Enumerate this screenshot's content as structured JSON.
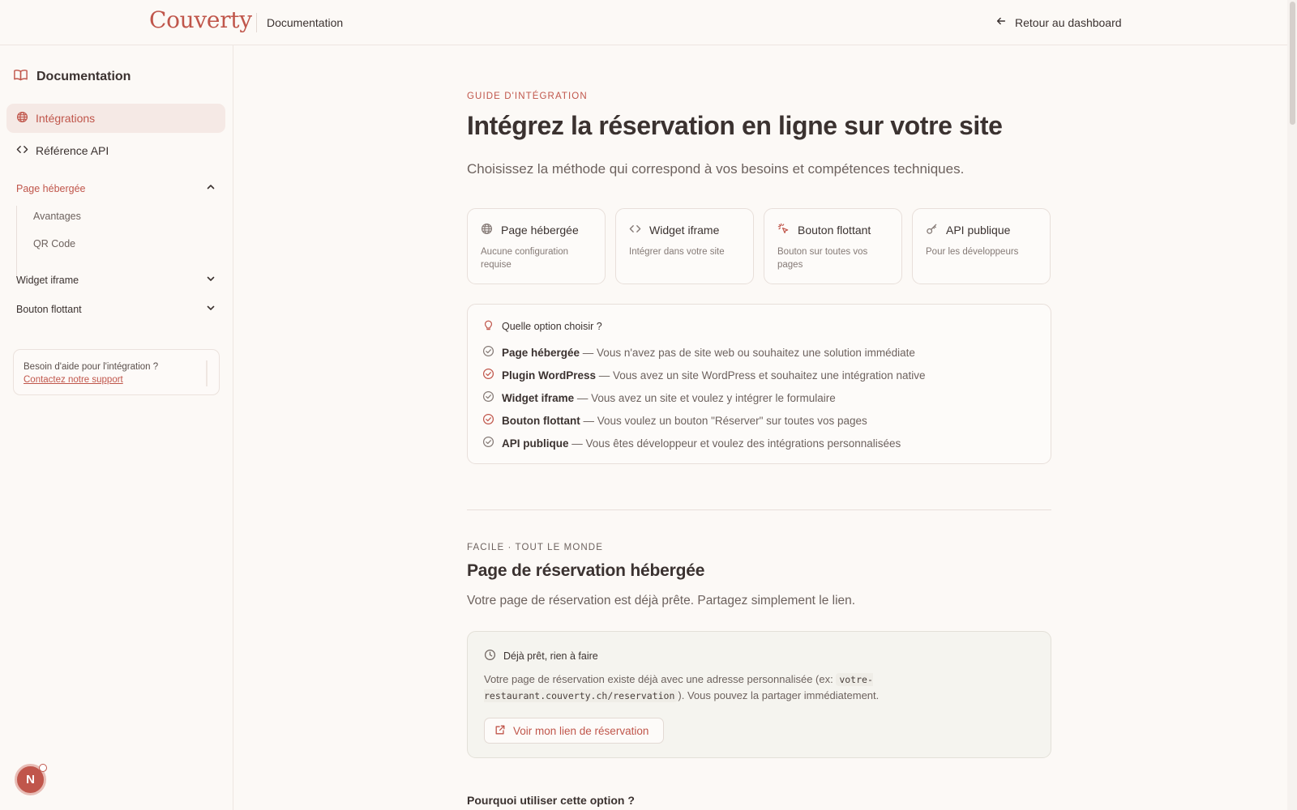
{
  "header": {
    "logo": "Couverty",
    "section": "Documentation",
    "back_label": "Retour au dashboard"
  },
  "sidebar": {
    "title": "Documentation",
    "nav": [
      {
        "label": "Intégrations",
        "icon": "globe-icon",
        "active": true
      },
      {
        "label": "Référence API",
        "icon": "code-icon",
        "active": false
      }
    ],
    "sections": [
      {
        "label": "Page hébergée",
        "expanded": true,
        "items": [
          "Avantages",
          "QR Code"
        ]
      },
      {
        "label": "Widget iframe",
        "expanded": false
      },
      {
        "label": "Bouton flottant",
        "expanded": false
      }
    ],
    "help": {
      "question": "Besoin d'aide pour l'intégration ?",
      "link": "Contactez notre support"
    },
    "avatar_letter": "N"
  },
  "main": {
    "eyebrow": "Guide d'intégration",
    "title": "Intégrez la réservation en ligne sur votre site",
    "lead": "Choisissez la méthode qui correspond à vos besoins et compétences techniques.",
    "cards": [
      {
        "title": "Page hébergée",
        "desc": "Aucune configuration requise",
        "icon": "globe-icon"
      },
      {
        "title": "Widget iframe",
        "desc": "Intégrer dans votre site",
        "icon": "code-icon"
      },
      {
        "title": "Bouton flottant",
        "desc": "Bouton sur toutes vos pages",
        "icon": "cursor-click-icon"
      },
      {
        "title": "API publique",
        "desc": "Pour les développeurs",
        "icon": "key-icon"
      }
    ],
    "options": {
      "title": "Quelle option choisir ?",
      "rows": [
        {
          "name": "Page hébergée",
          "text": " — Vous n'avez pas de site web ou souhaitez une solution immédiate",
          "highlight": false
        },
        {
          "name": "Plugin WordPress",
          "text": " — Vous avez un site WordPress et souhaitez une intégration native",
          "highlight": true
        },
        {
          "name": "Widget iframe",
          "text": " — Vous avez un site et voulez y intégrer le formulaire",
          "highlight": false
        },
        {
          "name": "Bouton flottant",
          "text": " — Vous voulez un bouton \"Réserver\" sur toutes vos pages",
          "highlight": true
        },
        {
          "name": "API publique",
          "text": " — Vous êtes développeur et voulez des intégrations personnalisées",
          "highlight": false
        }
      ]
    },
    "hosted": {
      "eyebrow": "Facile · Tout le monde",
      "title": "Page de réservation hébergée",
      "lead": "Votre page de réservation est déjà prête. Partagez simplement le lien.",
      "box_title": "Déjà prêt, rien à faire",
      "box_text_1": "Votre page de réservation existe déjà avec une adresse personnalisée (ex: ",
      "box_code": "votre-restaurant.couverty.ch/reservation",
      "box_text_2": "). Vous pouvez la partager immédiatement.",
      "button": "Voir mon lien de réservation",
      "why": "Pourquoi utiliser cette option ?"
    }
  },
  "colors": {
    "accent": "#c0564b",
    "background": "#fcf9f6",
    "text": "#3b3230",
    "muted": "#6d625e"
  }
}
